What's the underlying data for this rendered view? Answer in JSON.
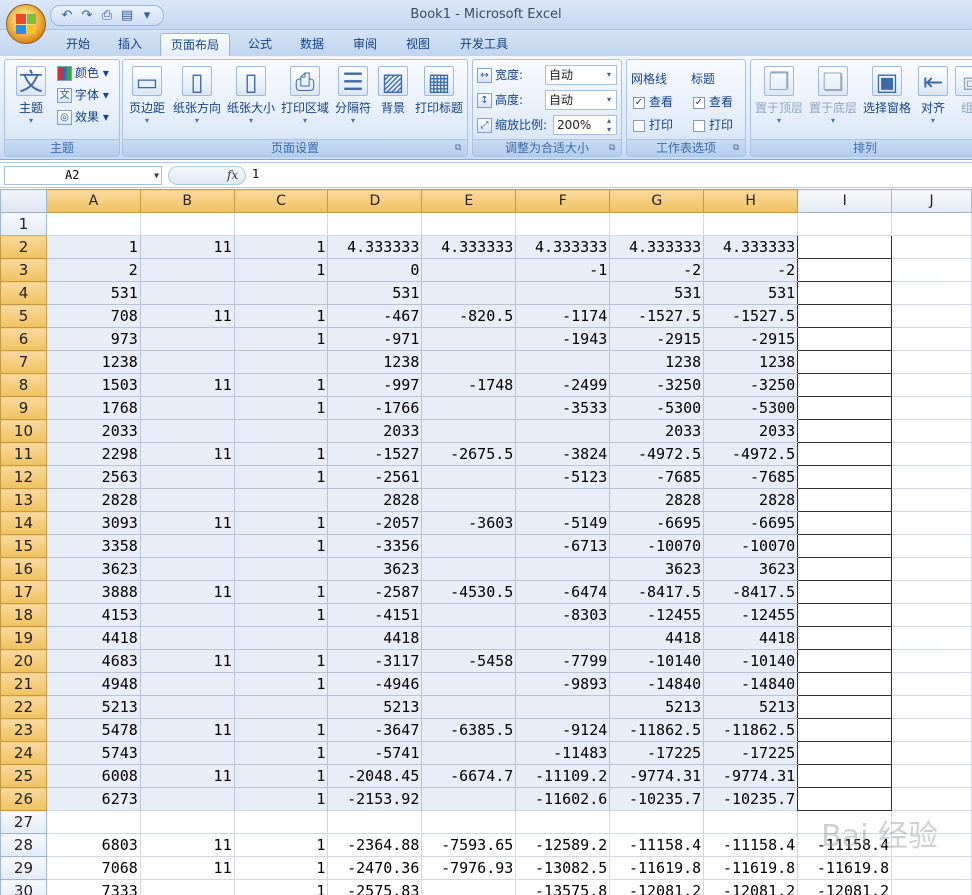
{
  "app": {
    "title": "Book1 - Microsoft Excel",
    "qat_icons": [
      "undo-icon",
      "redo-icon",
      "print-icon",
      "preview-icon",
      "customize-qat-icon"
    ]
  },
  "tabs": [
    "开始",
    "插入",
    "页面布局",
    "公式",
    "数据",
    "审阅",
    "视图",
    "开发工具"
  ],
  "active_tab": "页面布局",
  "ribbon": {
    "theme_group": {
      "label": "主题",
      "themes_btn": "主题",
      "colors": "颜色",
      "fonts": "字体",
      "effects": "效果"
    },
    "page_setup_group": {
      "label": "页面设置",
      "buttons": [
        "页边距",
        "纸张方向",
        "纸张大小",
        "打印区域",
        "分隔符",
        "背景",
        "打印标题"
      ]
    },
    "scale_group": {
      "label": "调整为合适大小",
      "width_label": "宽度:",
      "width_value": "自动",
      "height_label": "高度:",
      "height_value": "自动",
      "scale_label": "缩放比例:",
      "scale_value": "200%"
    },
    "sheet_options_group": {
      "label": "工作表选项",
      "gridlines": "网格线",
      "headings": "标题",
      "view": "查看",
      "print": "打印"
    },
    "arrange_group": {
      "label": "排列",
      "buttons": [
        "置于顶层",
        "置于底层",
        "选择窗格",
        "对齐",
        "组"
      ]
    }
  },
  "formula_bar": {
    "name_box": "A2",
    "fx": "fx",
    "content": "1"
  },
  "columns": [
    "A",
    "B",
    "C",
    "D",
    "E",
    "F",
    "G",
    "H",
    "I",
    "J"
  ],
  "rows": [
    {
      "n": "1",
      "c": [
        "",
        "",
        "",
        "",
        "",
        "",
        "",
        "",
        "",
        ""
      ]
    },
    {
      "n": "2",
      "c": [
        "1",
        "11",
        "1",
        "4.333333",
        "4.333333",
        "4.333333",
        "4.333333",
        "4.333333",
        "",
        ""
      ]
    },
    {
      "n": "3",
      "c": [
        "2",
        "",
        "1",
        "0",
        "",
        "-1",
        "-2",
        "-2",
        "",
        ""
      ]
    },
    {
      "n": "4",
      "c": [
        "531",
        "",
        "",
        "531",
        "",
        "",
        "531",
        "531",
        "",
        ""
      ]
    },
    {
      "n": "5",
      "c": [
        "708",
        "11",
        "1",
        "-467",
        "-820.5",
        "-1174",
        "-1527.5",
        "-1527.5",
        "",
        ""
      ]
    },
    {
      "n": "6",
      "c": [
        "973",
        "",
        "1",
        "-971",
        "",
        "-1943",
        "-2915",
        "-2915",
        "",
        ""
      ]
    },
    {
      "n": "7",
      "c": [
        "1238",
        "",
        "",
        "1238",
        "",
        "",
        "1238",
        "1238",
        "",
        ""
      ]
    },
    {
      "n": "8",
      "c": [
        "1503",
        "11",
        "1",
        "-997",
        "-1748",
        "-2499",
        "-3250",
        "-3250",
        "",
        ""
      ]
    },
    {
      "n": "9",
      "c": [
        "1768",
        "",
        "1",
        "-1766",
        "",
        "-3533",
        "-5300",
        "-5300",
        "",
        ""
      ]
    },
    {
      "n": "10",
      "c": [
        "2033",
        "",
        "",
        "2033",
        "",
        "",
        "2033",
        "2033",
        "",
        ""
      ]
    },
    {
      "n": "11",
      "c": [
        "2298",
        "11",
        "1",
        "-1527",
        "-2675.5",
        "-3824",
        "-4972.5",
        "-4972.5",
        "",
        ""
      ]
    },
    {
      "n": "12",
      "c": [
        "2563",
        "",
        "1",
        "-2561",
        "",
        "-5123",
        "-7685",
        "-7685",
        "",
        ""
      ]
    },
    {
      "n": "13",
      "c": [
        "2828",
        "",
        "",
        "2828",
        "",
        "",
        "2828",
        "2828",
        "",
        ""
      ]
    },
    {
      "n": "14",
      "c": [
        "3093",
        "11",
        "1",
        "-2057",
        "-3603",
        "-5149",
        "-6695",
        "-6695",
        "",
        ""
      ]
    },
    {
      "n": "15",
      "c": [
        "3358",
        "",
        "1",
        "-3356",
        "",
        "-6713",
        "-10070",
        "-10070",
        "",
        ""
      ]
    },
    {
      "n": "16",
      "c": [
        "3623",
        "",
        "",
        "3623",
        "",
        "",
        "3623",
        "3623",
        "",
        ""
      ]
    },
    {
      "n": "17",
      "c": [
        "3888",
        "11",
        "1",
        "-2587",
        "-4530.5",
        "-6474",
        "-8417.5",
        "-8417.5",
        "",
        ""
      ]
    },
    {
      "n": "18",
      "c": [
        "4153",
        "",
        "1",
        "-4151",
        "",
        "-8303",
        "-12455",
        "-12455",
        "",
        ""
      ]
    },
    {
      "n": "19",
      "c": [
        "4418",
        "",
        "",
        "4418",
        "",
        "",
        "4418",
        "4418",
        "",
        ""
      ]
    },
    {
      "n": "20",
      "c": [
        "4683",
        "11",
        "1",
        "-3117",
        "-5458",
        "-7799",
        "-10140",
        "-10140",
        "",
        ""
      ]
    },
    {
      "n": "21",
      "c": [
        "4948",
        "",
        "1",
        "-4946",
        "",
        "-9893",
        "-14840",
        "-14840",
        "",
        ""
      ]
    },
    {
      "n": "22",
      "c": [
        "5213",
        "",
        "",
        "5213",
        "",
        "",
        "5213",
        "5213",
        "",
        ""
      ]
    },
    {
      "n": "23",
      "c": [
        "5478",
        "11",
        "1",
        "-3647",
        "-6385.5",
        "-9124",
        "-11862.5",
        "-11862.5",
        "",
        ""
      ]
    },
    {
      "n": "24",
      "c": [
        "5743",
        "",
        "1",
        "-5741",
        "",
        "-11483",
        "-17225",
        "-17225",
        "",
        ""
      ]
    },
    {
      "n": "25",
      "c": [
        "6008",
        "11",
        "1",
        "-2048.45",
        "-6674.7",
        "-11109.2",
        "-9774.31",
        "-9774.31",
        "",
        ""
      ]
    },
    {
      "n": "26",
      "c": [
        "6273",
        "",
        "1",
        "-2153.92",
        "",
        "-11602.6",
        "-10235.7",
        "-10235.7",
        "",
        ""
      ]
    },
    {
      "n": "27",
      "c": [
        "",
        "",
        "",
        "",
        "",
        "",
        "",
        "",
        "",
        ""
      ]
    },
    {
      "n": "28",
      "c": [
        "6803",
        "11",
        "1",
        "-2364.88",
        "-7593.65",
        "-12589.2",
        "-11158.4",
        "-11158.4",
        "-11158.4",
        ""
      ]
    },
    {
      "n": "29",
      "c": [
        "7068",
        "11",
        "1",
        "-2470.36",
        "-7976.93",
        "-13082.5",
        "-11619.8",
        "-11619.8",
        "-11619.8",
        ""
      ]
    },
    {
      "n": "30",
      "c": [
        "7333",
        "",
        "1",
        "-2575.83",
        "",
        "-13575.8",
        "-12081.2",
        "-12081.2",
        "-12081.2",
        ""
      ]
    }
  ],
  "colors": {
    "selection_fill": "#e9edf7",
    "header_selected": "#f1c15f",
    "ribbon_bg": "#dde9f8"
  }
}
